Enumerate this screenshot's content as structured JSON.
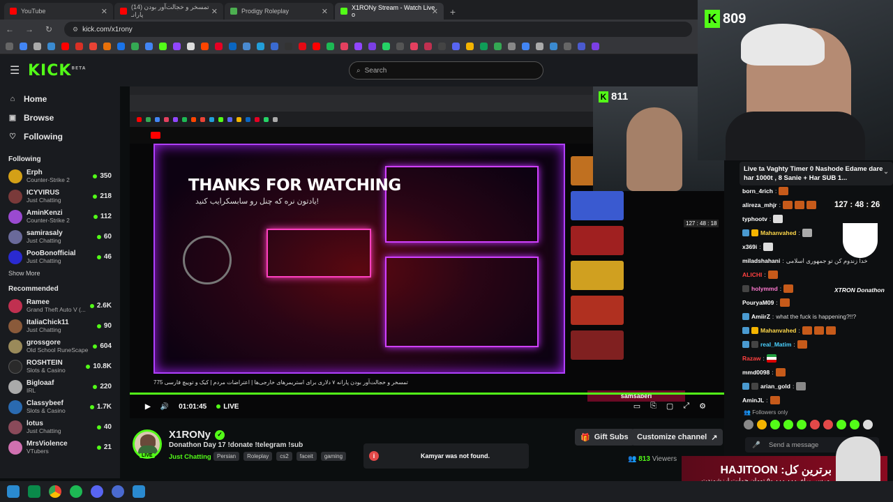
{
  "browser": {
    "tabs": [
      {
        "label": "YouTube",
        "color": "#ff0000"
      },
      {
        "label": "(14) تمسخر و خجالت‌آور بودن پارانـ",
        "color": "#ff0000"
      },
      {
        "label": "Prodigy Roleplay",
        "color": "#4caf50"
      },
      {
        "label": "X1RONy Stream - Watch Live o",
        "color": "#53fc18"
      }
    ],
    "url": "kick.com/x1rony"
  },
  "header": {
    "logo": "KICK",
    "logo_sup": "BETA",
    "search_placeholder": "Search"
  },
  "sidebar": {
    "nav": [
      {
        "label": "Home",
        "icon": "home-icon"
      },
      {
        "label": "Browse",
        "icon": "browse-icon"
      },
      {
        "label": "Following",
        "icon": "heart-icon"
      }
    ],
    "following_heading": "Following",
    "following": [
      {
        "name": "Erph",
        "category": "Counter-Strike 2",
        "viewers": "350",
        "color": "#d4a017"
      },
      {
        "name": "ICYVIRUS",
        "category": "Just Chatting",
        "viewers": "218",
        "color": "#7a3a3a"
      },
      {
        "name": "AminKenzi",
        "category": "Counter-Strike 2",
        "viewers": "112",
        "color": "#9a4ad0"
      },
      {
        "name": "samirasaly",
        "category": "Just Chatting",
        "viewers": "60",
        "color": "#6a6a9a"
      },
      {
        "name": "PooBonofficial",
        "category": "Just Chatting",
        "viewers": "46",
        "color": "#2a2ad0"
      }
    ],
    "show_more": "Show More",
    "recommended_heading": "Recommended",
    "recommended": [
      {
        "name": "Ramee",
        "category": "Grand Theft Auto V (...",
        "viewers": "2.6K",
        "color": "#c03050"
      },
      {
        "name": "ItaliaChick11",
        "category": "Just Chatting",
        "viewers": "90",
        "color": "#8a5a3a"
      },
      {
        "name": "grossgore",
        "category": "Old School RuneScape",
        "viewers": "604",
        "color": "#9a8a5a"
      },
      {
        "name": "ROSHTEIN",
        "category": "Slots & Casino",
        "viewers": "10.8K",
        "color": "#2a2a2a"
      },
      {
        "name": "Bigloaaf",
        "category": "IRL",
        "viewers": "220",
        "color": "#aaaaaa"
      },
      {
        "name": "Classybeef",
        "category": "Slots & Casino",
        "viewers": "1.7K",
        "color": "#2a6ab0"
      },
      {
        "name": "lotus",
        "category": "Just Chatting",
        "viewers": "40",
        "color": "#8a4a5a"
      },
      {
        "name": "MrsViolence",
        "category": "VTubers",
        "viewers": "21",
        "color": "#d070b0"
      }
    ]
  },
  "player": {
    "inner_k_count": "811",
    "thanks_text": "THANKS FOR WATCHING",
    "thanks_sub": "یادتون نره که چنل رو سابسکرایب کنید!",
    "inner_timer": "127 : 48 : 18",
    "inner_video_title": "تمسخر و خجالت‌آور بودن پارانه ۷ دلاری برای استریمرهای خارجی‌ها | اعتراضات مردم | کیک و توییچ فارسی 775",
    "overlay_name": "samsaberi",
    "time": "01:01:45",
    "live_label": "LIVE"
  },
  "channel": {
    "name": "X1RONy",
    "title": "Donathon Day 17  !donate !telegram !sub",
    "category": "Just Chatting",
    "tags": [
      "Persian",
      "Roleplay",
      "cs2",
      "faceit",
      "gaming"
    ],
    "gift_subs": "Gift Subs",
    "customize": "Customize channel",
    "viewers_count": "813",
    "viewers_label": "Viewers",
    "live_badge": "LIVE"
  },
  "toast": {
    "text": "Kamyar was not found."
  },
  "webcam": {
    "k_count": "809"
  },
  "chat": {
    "pinned": "Live ta Vaghty Timer 0 Nashode Edame dare har 1000t , 8 Sanie + Har SUB 1...",
    "timer": "127 : 48 : 26",
    "overlay_brand": "XTRON Donathon",
    "messages": [
      {
        "user": "born_4rich",
        "text": "",
        "color": "#ffffff"
      },
      {
        "user": "alireza_mhjr",
        "text": "",
        "color": "#ffffff"
      },
      {
        "user": "typhootv",
        "text": "",
        "color": "#ffffff"
      },
      {
        "user": "Mahanvahed",
        "text": "",
        "color": "#ffd84a"
      },
      {
        "user": "x369i",
        "text": "",
        "color": "#ffffff"
      },
      {
        "user": "miladshahani",
        "text": "خدا زندوم کن تو جمهوری اسلامی",
        "color": "#ffffff"
      },
      {
        "user": "ALICHI",
        "text": "",
        "color": "#ff4040"
      },
      {
        "user": "holymmd",
        "text": "",
        "color": "#ff7ad0"
      },
      {
        "user": "PouryaM09",
        "text": "",
        "color": "#ffffff"
      },
      {
        "user": "AmiirZ",
        "text": "what the fuck is happening?!!?",
        "color": "#ffffff"
      },
      {
        "user": "Mahanvahed",
        "text": "",
        "color": "#ffd84a"
      },
      {
        "user": "real_Matim",
        "text": "",
        "color": "#4ad0ff"
      },
      {
        "user": "Razaw",
        "text": "",
        "color": "#ff4040"
      },
      {
        "user": "mmd0098",
        "text": "",
        "color": "#ffffff"
      },
      {
        "user": "arian_gold",
        "text": "",
        "color": "#ffffff"
      },
      {
        "user": "AminJL",
        "text": "",
        "color": "#ffffff"
      }
    ],
    "followers_only": "Followers only",
    "send_placeholder": "Send a message"
  },
  "ad": {
    "title": "HAJITOON :برترین کل",
    "sub": "مرسی برای ۵۰,۰۰۰,۰۰۰ تومان حمایت ارزشمندت."
  }
}
